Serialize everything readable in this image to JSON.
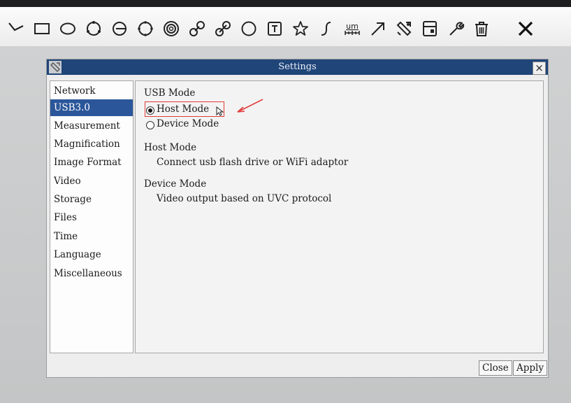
{
  "toolbar": {
    "tools": [
      {
        "icon": "line-icon"
      },
      {
        "icon": "rectangle-icon"
      },
      {
        "icon": "ellipse-icon"
      },
      {
        "icon": "multi-point-circle-icon"
      },
      {
        "icon": "circle-with-line-icon"
      },
      {
        "icon": "circle-icon"
      },
      {
        "icon": "concentric-circles-icon"
      },
      {
        "icon": "link-icon"
      },
      {
        "icon": "link-alt-icon"
      },
      {
        "icon": "arc-circle-icon"
      },
      {
        "icon": "text-icon"
      },
      {
        "icon": "star-icon"
      },
      {
        "icon": "curve-icon"
      },
      {
        "icon": "scale-bar-icon",
        "label": "um"
      },
      {
        "icon": "arrow-icon"
      },
      {
        "icon": "settings-icon"
      },
      {
        "icon": "save-icon"
      },
      {
        "icon": "wrench-icon"
      },
      {
        "icon": "trash-icon"
      },
      {
        "icon": "close-icon"
      }
    ]
  },
  "dialog": {
    "title": "Settings",
    "close_glyph": "×",
    "sidebar": {
      "selected": "USB3.0",
      "items": [
        {
          "label": "Network"
        },
        {
          "label": "USB3.0"
        },
        {
          "label": "Measurement"
        },
        {
          "label": "Magnification"
        },
        {
          "label": "Image Format"
        },
        {
          "label": "Video"
        },
        {
          "label": "Storage"
        },
        {
          "label": "Files"
        },
        {
          "label": "Time"
        },
        {
          "label": "Language"
        },
        {
          "label": "Miscellaneous"
        }
      ]
    },
    "panel": {
      "group_title": "USB Mode",
      "options": [
        {
          "label": "Host Mode",
          "checked": true
        },
        {
          "label": "Device Mode",
          "checked": false
        }
      ],
      "host": {
        "heading": "Host Mode",
        "description": "Connect usb flash drive or WiFi adaptor"
      },
      "device": {
        "heading": "Device Mode",
        "description": "Video output based on UVC protocol"
      }
    },
    "buttons": {
      "close": "Close",
      "apply": "Apply"
    }
  },
  "annotation": {
    "color": "#e23c3c"
  }
}
